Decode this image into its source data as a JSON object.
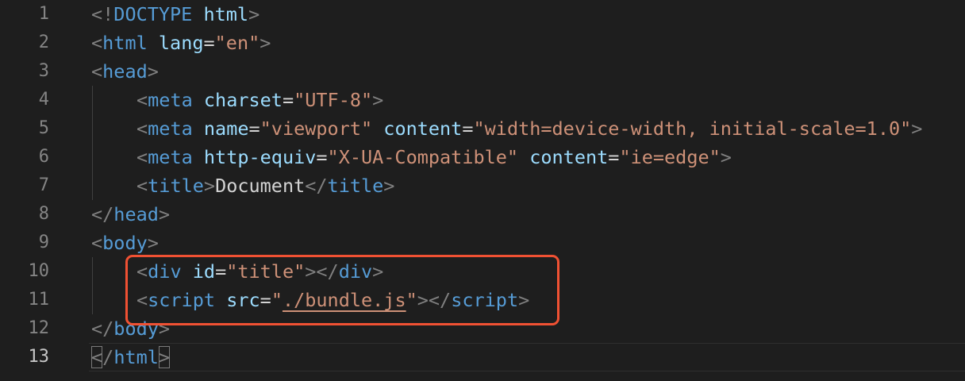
{
  "editor": {
    "language": "html",
    "current_line": "13",
    "lines": [
      {
        "number": "1",
        "tokens": [
          {
            "t": "<!",
            "k": "punct"
          },
          {
            "t": "DOCTYPE",
            "k": "tag"
          },
          {
            "t": " html",
            "k": "attr"
          },
          {
            "t": ">",
            "k": "punct"
          }
        ]
      },
      {
        "number": "2",
        "tokens": [
          {
            "t": "<",
            "k": "punct"
          },
          {
            "t": "html",
            "k": "tag"
          },
          {
            "t": " ",
            "k": "text"
          },
          {
            "t": "lang",
            "k": "attr"
          },
          {
            "t": "=",
            "k": "text"
          },
          {
            "t": "\"en\"",
            "k": "str"
          },
          {
            "t": ">",
            "k": "punct"
          }
        ]
      },
      {
        "number": "3",
        "tokens": [
          {
            "t": "<",
            "k": "punct"
          },
          {
            "t": "head",
            "k": "tag"
          },
          {
            "t": ">",
            "k": "punct"
          }
        ]
      },
      {
        "number": "4",
        "tokens": [
          {
            "t": "<",
            "k": "punct"
          },
          {
            "t": "meta",
            "k": "tag"
          },
          {
            "t": " ",
            "k": "text"
          },
          {
            "t": "charset",
            "k": "attr"
          },
          {
            "t": "=",
            "k": "text"
          },
          {
            "t": "\"UTF-8\"",
            "k": "str"
          },
          {
            "t": ">",
            "k": "punct"
          }
        ]
      },
      {
        "number": "5",
        "tokens": [
          {
            "t": "<",
            "k": "punct"
          },
          {
            "t": "meta",
            "k": "tag"
          },
          {
            "t": " ",
            "k": "text"
          },
          {
            "t": "name",
            "k": "attr"
          },
          {
            "t": "=",
            "k": "text"
          },
          {
            "t": "\"viewport\"",
            "k": "str"
          },
          {
            "t": " ",
            "k": "text"
          },
          {
            "t": "content",
            "k": "attr"
          },
          {
            "t": "=",
            "k": "text"
          },
          {
            "t": "\"width=device-width, initial-scale=1.0\"",
            "k": "str"
          },
          {
            "t": ">",
            "k": "punct"
          }
        ]
      },
      {
        "number": "6",
        "tokens": [
          {
            "t": "<",
            "k": "punct"
          },
          {
            "t": "meta",
            "k": "tag"
          },
          {
            "t": " ",
            "k": "text"
          },
          {
            "t": "http-equiv",
            "k": "attr"
          },
          {
            "t": "=",
            "k": "text"
          },
          {
            "t": "\"X-UA-Compatible\"",
            "k": "str"
          },
          {
            "t": " ",
            "k": "text"
          },
          {
            "t": "content",
            "k": "attr"
          },
          {
            "t": "=",
            "k": "text"
          },
          {
            "t": "\"ie=edge\"",
            "k": "str"
          },
          {
            "t": ">",
            "k": "punct"
          }
        ]
      },
      {
        "number": "7",
        "tokens": [
          {
            "t": "<",
            "k": "punct"
          },
          {
            "t": "title",
            "k": "tag"
          },
          {
            "t": ">",
            "k": "punct"
          },
          {
            "t": "Document",
            "k": "text"
          },
          {
            "t": "</",
            "k": "punct"
          },
          {
            "t": "title",
            "k": "tag"
          },
          {
            "t": ">",
            "k": "punct"
          }
        ]
      },
      {
        "number": "8",
        "tokens": [
          {
            "t": "</",
            "k": "punct"
          },
          {
            "t": "head",
            "k": "tag"
          },
          {
            "t": ">",
            "k": "punct"
          }
        ]
      },
      {
        "number": "9",
        "tokens": [
          {
            "t": "<",
            "k": "punct"
          },
          {
            "t": "body",
            "k": "tag"
          },
          {
            "t": ">",
            "k": "punct"
          }
        ]
      },
      {
        "number": "10",
        "tokens": [
          {
            "t": "<",
            "k": "punct"
          },
          {
            "t": "div",
            "k": "tag"
          },
          {
            "t": " ",
            "k": "text"
          },
          {
            "t": "id",
            "k": "attr"
          },
          {
            "t": "=",
            "k": "text"
          },
          {
            "t": "\"title\"",
            "k": "str"
          },
          {
            "t": "></",
            "k": "punct"
          },
          {
            "t": "div",
            "k": "tag"
          },
          {
            "t": ">",
            "k": "punct"
          }
        ]
      },
      {
        "number": "11",
        "tokens": [
          {
            "t": "<",
            "k": "punct"
          },
          {
            "t": "script",
            "k": "tag"
          },
          {
            "t": " ",
            "k": "text"
          },
          {
            "t": "src",
            "k": "attr"
          },
          {
            "t": "=",
            "k": "text"
          },
          {
            "t": "\"",
            "k": "str"
          },
          {
            "t": "./bundle.js",
            "k": "link"
          },
          {
            "t": "\"",
            "k": "str"
          },
          {
            "t": "></",
            "k": "punct"
          },
          {
            "t": "script",
            "k": "tag"
          },
          {
            "t": ">",
            "k": "punct"
          }
        ]
      },
      {
        "number": "12",
        "tokens": [
          {
            "t": "</",
            "k": "punct"
          },
          {
            "t": "body",
            "k": "tag"
          },
          {
            "t": ">",
            "k": "punct"
          }
        ]
      },
      {
        "number": "13",
        "tokens": [
          {
            "t": "<",
            "k": "punct",
            "match": true
          },
          {
            "t": "/",
            "k": "punct"
          },
          {
            "t": "html",
            "k": "tag"
          },
          {
            "t": ">",
            "k": "punct",
            "match": true
          }
        ]
      }
    ]
  },
  "theme": {
    "background": "#1e1e1e",
    "tag": "#569cd6",
    "attribute": "#9cdcfe",
    "string": "#ce9178",
    "punctuation": "#808080",
    "text": "#d4d4d4",
    "line_number": "#858585",
    "annotation_box": "#f05133"
  }
}
